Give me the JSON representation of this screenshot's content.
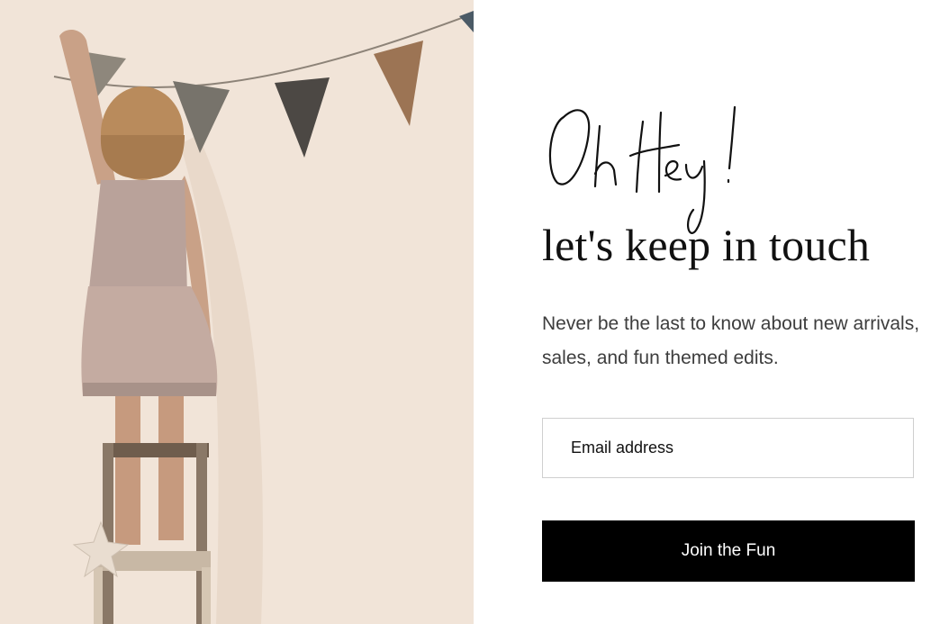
{
  "popup": {
    "script_heading": "Oh Hey!",
    "subheading": "let's keep in touch",
    "description": "Never be the last to know about new arrivals, sales, and fun themed edits.",
    "email_placeholder": "Email address",
    "submit_label": "Join the Fun"
  },
  "photo": {
    "icon": "promo-photo"
  },
  "colors": {
    "button_bg": "#000000",
    "button_text": "#ffffff",
    "heading_text": "#111111",
    "body_text": "#3d3d3d",
    "input_border": "#cfcfcf",
    "photo_wall": "#f1e4d8"
  }
}
